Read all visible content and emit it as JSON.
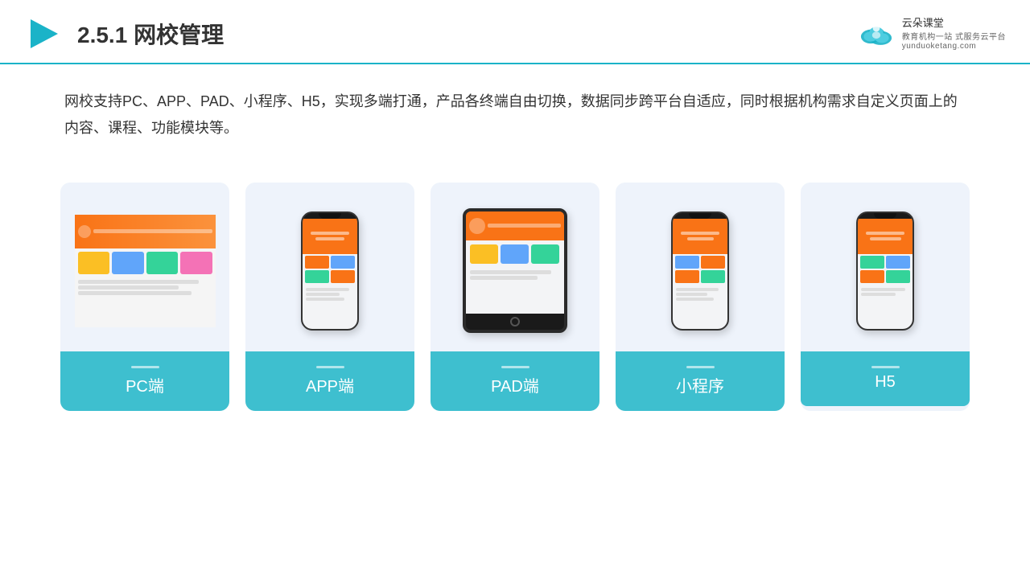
{
  "header": {
    "title": "2.5.1网校管理",
    "title_num": "2.5.1",
    "title_text": "网校管理",
    "brand_name": "云朵课堂",
    "brand_url": "yunduoketang.com",
    "brand_tagline1": "教育机构一站",
    "brand_tagline2": "式服务云平台"
  },
  "description": {
    "text": "网校支持PC、APP、PAD、小程序、H5，实现多端打通，产品各终端自由切换，数据同步跨平台自适应，同时根据机构需求自定义页面上的内容、课程、功能模块等。"
  },
  "cards": [
    {
      "id": "pc",
      "label": "PC端"
    },
    {
      "id": "app",
      "label": "APP端"
    },
    {
      "id": "pad",
      "label": "PAD端"
    },
    {
      "id": "miniapp",
      "label": "小程序"
    },
    {
      "id": "h5",
      "label": "H5"
    }
  ]
}
